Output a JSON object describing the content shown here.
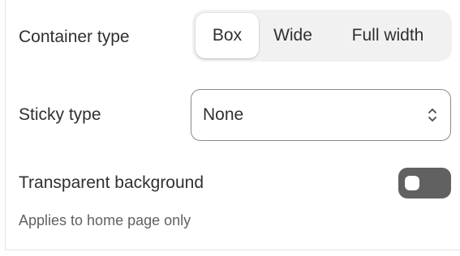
{
  "container_type": {
    "label": "Container type",
    "options": [
      {
        "label": "Box",
        "selected": true
      },
      {
        "label": "Wide",
        "selected": false
      },
      {
        "label": "Full width",
        "selected": false
      }
    ]
  },
  "sticky_type": {
    "label": "Sticky type",
    "value": "None",
    "icon": "chevron-up-down-icon"
  },
  "transparent_background": {
    "label": "Transparent background",
    "enabled": false,
    "help_text": "Applies to home page only"
  },
  "colors": {
    "toggle_off": "#616161",
    "segment_track": "#f1f1f1",
    "text": "#303030",
    "muted_text": "#616161"
  }
}
